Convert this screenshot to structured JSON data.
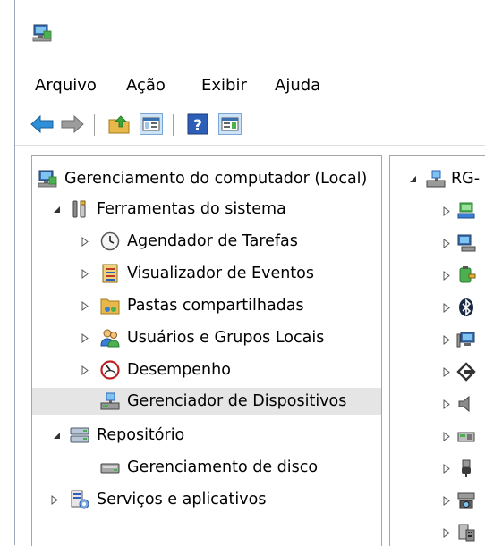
{
  "menu": {
    "file": "Arquivo",
    "action": "Ação",
    "view": "Exibir",
    "help": "Ajuda"
  },
  "tree": {
    "root": "Gerenciamento do computador (Local)",
    "system_tools": "Ferramentas do sistema",
    "task_scheduler": "Agendador de Tarefas",
    "event_viewer": "Visualizador de Eventos",
    "shared_folders": "Pastas compartilhadas",
    "local_users": "Usuários e Grupos Locais",
    "performance": "Desempenho",
    "device_manager": "Gerenciador de Dispositivos",
    "storage": "Repositório",
    "disk_management": "Gerenciamento de disco",
    "services_apps": "Serviços e aplicativos"
  },
  "right_pane": {
    "computer_name": "RG-"
  },
  "colors": {
    "accent_blue": "#2a8ad4",
    "selected_row": "#e5e5e5",
    "pane_border": "#a6a6a6"
  }
}
